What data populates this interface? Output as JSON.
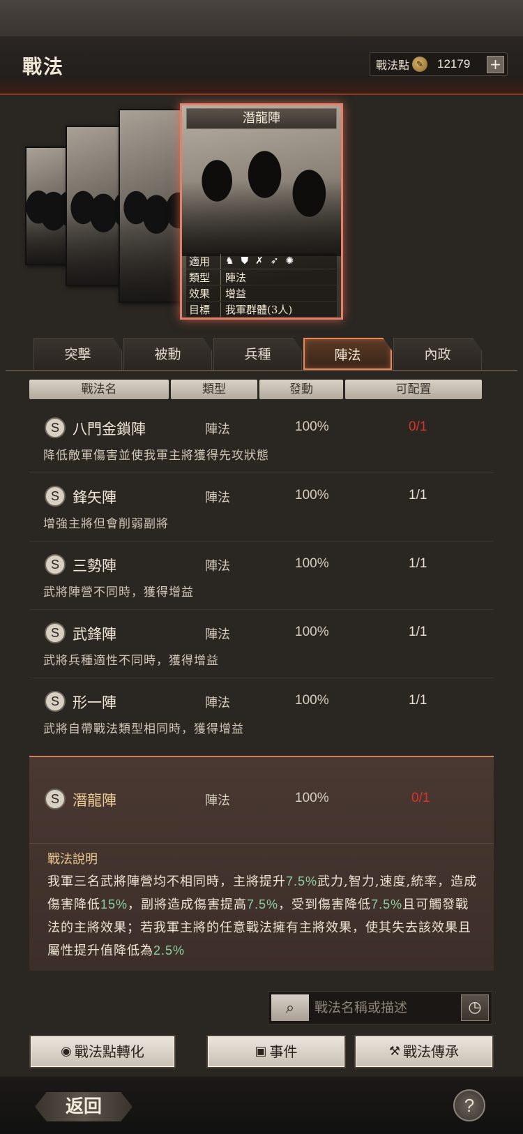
{
  "header": {
    "title": "戰法",
    "points_label": "戰法點",
    "points_icon": "coin-icon",
    "points_value": "12179",
    "plus_label": "+"
  },
  "card": {
    "title": "潛龍陣",
    "rows": [
      {
        "key": "適用",
        "value": ""
      },
      {
        "key": "類型",
        "value": "陣法"
      },
      {
        "key": "效果",
        "value": "增益"
      },
      {
        "key": "目標",
        "value": "我軍群體(3人)"
      }
    ],
    "unit_icons": [
      "cavalry-icon",
      "shield-icon",
      "archer-icon",
      "spear-icon",
      "siege-icon"
    ]
  },
  "tabs": [
    {
      "label": "突擊",
      "active": false
    },
    {
      "label": "被動",
      "active": false
    },
    {
      "label": "兵種",
      "active": false
    },
    {
      "label": "陣法",
      "active": true
    },
    {
      "label": "內政",
      "active": false
    }
  ],
  "columns": [
    "戰法名",
    "類型",
    "發動",
    "可配置"
  ],
  "tactics": [
    {
      "grade": "S",
      "name": "八門金鎖陣",
      "type": "陣法",
      "rate": "100%",
      "slots": "0/1",
      "slots_red": true,
      "desc": "降低敵軍傷害並使我軍主將獲得先攻狀態"
    },
    {
      "grade": "S",
      "name": "鋒矢陣",
      "type": "陣法",
      "rate": "100%",
      "slots": "1/1",
      "slots_red": false,
      "desc": "增強主將但會削弱副將"
    },
    {
      "grade": "S",
      "name": "三勢陣",
      "type": "陣法",
      "rate": "100%",
      "slots": "1/1",
      "slots_red": false,
      "desc": "武將陣營不同時，獲得增益"
    },
    {
      "grade": "S",
      "name": "武鋒陣",
      "type": "陣法",
      "rate": "100%",
      "slots": "1/1",
      "slots_red": false,
      "desc": "武將兵種適性不同時，獲得增益"
    },
    {
      "grade": "S",
      "name": "形一陣",
      "type": "陣法",
      "rate": "100%",
      "slots": "1/1",
      "slots_red": false,
      "desc": "武將自帶戰法類型相同時，獲得增益"
    }
  ],
  "selected": {
    "grade": "S",
    "name": "潛龍陣",
    "type": "陣法",
    "rate": "100%",
    "slots": "0/1",
    "desc_title": "戰法說明",
    "desc_parts": [
      "我軍三名武將陣營均不相同時，主將提升",
      "7.5%",
      "武力,智力,速度,統率，造成傷害降低",
      "15%",
      "，副將造成傷害提高",
      "7.5%",
      "，受到傷害降低",
      "7.5%",
      "且可觸發戰法的主將效果；若我軍主將的任意戰法擁有主將效果，使其失去該效果且屬性提升值降低為",
      "2.5%"
    ]
  },
  "search": {
    "placeholder": "戰法名稱或描述",
    "icon": "search-icon",
    "history_icon": "clock-icon"
  },
  "buttons": {
    "convert": "戰法點轉化",
    "events": "事件",
    "inherit": "戰法傳承"
  },
  "footer": {
    "back": "返回",
    "help": "?"
  }
}
